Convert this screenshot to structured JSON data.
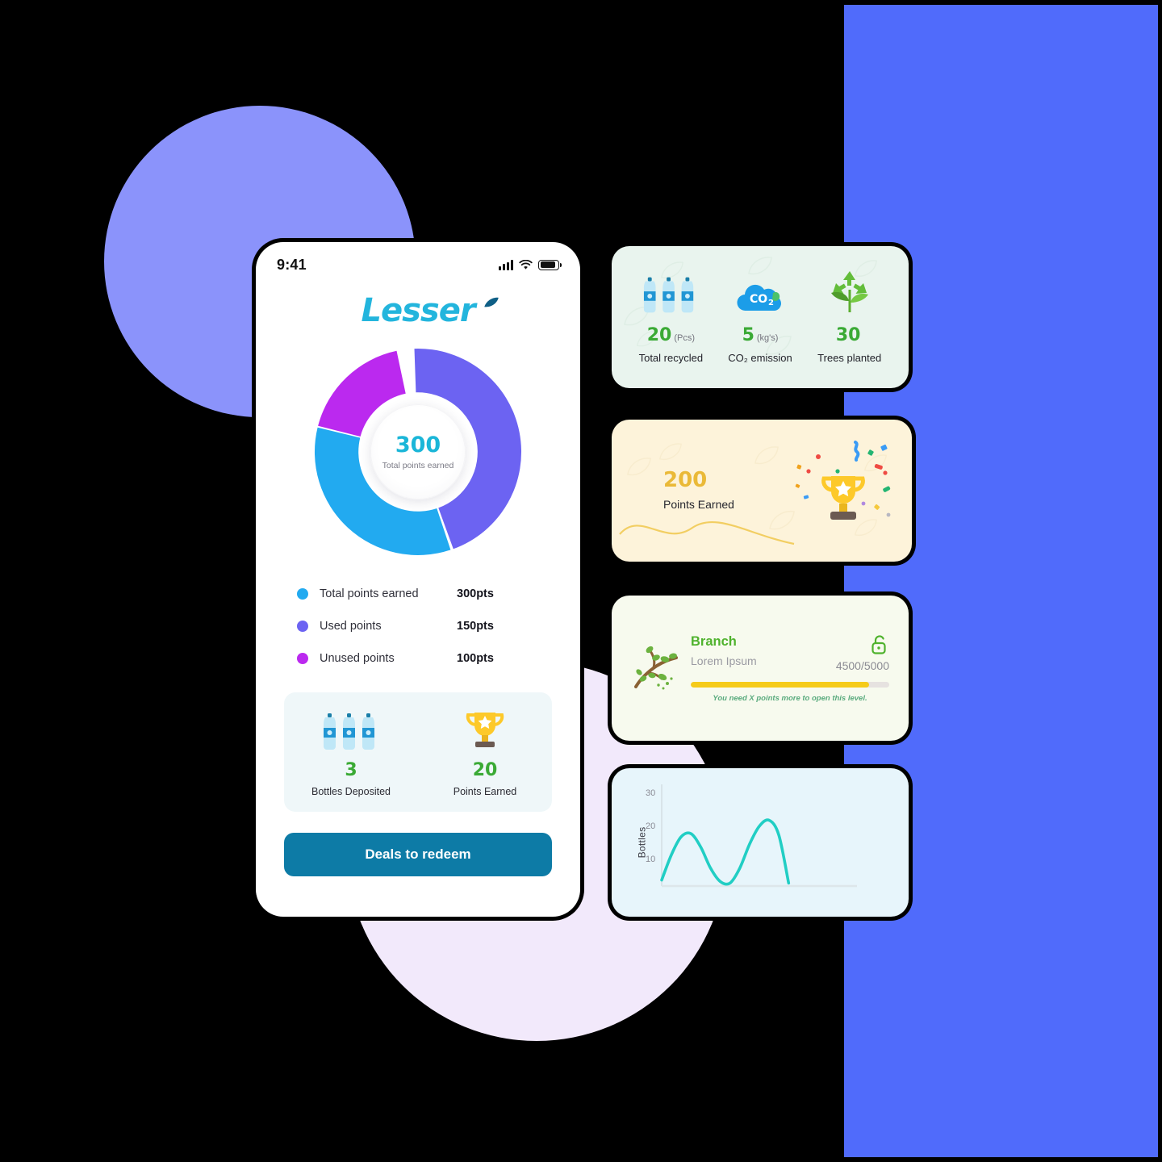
{
  "background": {
    "page_color": "#000000",
    "circle_periwinkle_color": "#8b93fb",
    "circle_lavender_color": "#f2e9fb",
    "panel_blue_color": "#506bfb"
  },
  "phone": {
    "status_bar": {
      "time": "9:41",
      "icons": [
        "signal-icon",
        "wifi-icon",
        "battery-icon"
      ]
    },
    "brand": {
      "name": "Lesser",
      "color": "#23b5dd",
      "leaf_color": "#0f5f86"
    },
    "donut": {
      "center_value": "300",
      "center_label": "Total points earned",
      "value_color": "#1bb6d8"
    },
    "legend": [
      {
        "label": "Total points earned",
        "value": "300pts",
        "color": "#22aaf0"
      },
      {
        "label": "Used points",
        "value": "150pts",
        "color": "#6c63f2"
      },
      {
        "label": "Unused points",
        "value": "100pts",
        "color": "#bb29ef"
      }
    ],
    "stats": [
      {
        "icon": "water-bottles-icon",
        "value": "3",
        "caption": "Bottles Deposited"
      },
      {
        "icon": "trophy-icon",
        "value": "20",
        "caption": "Points Earned"
      }
    ],
    "cta": {
      "label": "Deals to redeem",
      "color": "#0d7ba6"
    }
  },
  "cards": {
    "eco": {
      "items": [
        {
          "icon": "water-bottles-icon",
          "value": "20",
          "unit": "(Pcs)",
          "caption": "Total recycled"
        },
        {
          "icon": "co2-cloud-icon",
          "value": "5",
          "unit": "(kg's)",
          "caption": "CO₂ emission"
        },
        {
          "icon": "recycle-plant-icon",
          "value": "30",
          "unit": "",
          "caption": "Trees planted"
        }
      ],
      "bg_color": "#e9f4ee",
      "value_color": "#3aaa35"
    },
    "points": {
      "value": "200",
      "caption": "Points Earned",
      "icon": "trophy-confetti-icon",
      "bg_color": "#fdf3da",
      "value_color": "#eab937"
    },
    "level": {
      "title": "Branch",
      "subtitle": "Lorem Ipsum",
      "progress_text": "4500/5000",
      "progress_percent": 90,
      "note": "You need X points more to open this level.",
      "lock_icon": "unlocked-padlock-icon",
      "art_icon": "branch-icon",
      "bg_color": "#f7faee",
      "title_color": "#4fb22d",
      "bar_color": "#f5cb1a"
    }
  },
  "chart_data": {
    "type": "line",
    "title": "",
    "xlabel": "",
    "ylabel": "Bottles",
    "yticks": [
      10,
      20,
      30
    ],
    "ylim": [
      0,
      34
    ],
    "xlim": [
      0,
      10
    ],
    "grid": false,
    "legend": "none",
    "line_color": "#21cec4",
    "series": [
      {
        "name": "Bottles",
        "x": [
          0.0,
          0.5,
          1.0,
          1.5,
          2.0,
          2.5,
          3.0,
          3.5,
          4.0,
          4.5,
          5.0,
          5.5,
          6.0,
          6.5
        ],
        "y": [
          2.0,
          10.5,
          16.5,
          17.5,
          13.0,
          6.0,
          1.5,
          1.0,
          6.0,
          14.0,
          20.0,
          22.0,
          17.0,
          1.0
        ]
      }
    ]
  }
}
